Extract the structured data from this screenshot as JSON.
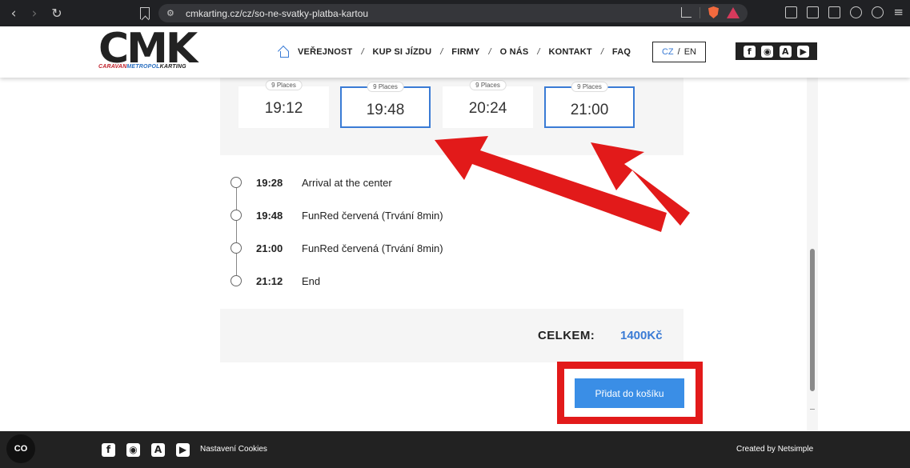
{
  "browser": {
    "url": "cmkarting.cz/cz/so-ne-svatky-platba-kartou"
  },
  "header": {
    "logo_text": "CMK",
    "logo_sub": [
      "CARAVAN",
      "METROPOL",
      "KARTING"
    ],
    "nav": [
      "VEŘEJNOST",
      "KUP SI JÍZDU",
      "FIRMY",
      "O NÁS",
      "KONTAKT",
      "FAQ"
    ],
    "lang": {
      "cz": "CZ",
      "slash": "/",
      "en": "EN"
    }
  },
  "slots": [
    {
      "badge": "9 Places",
      "time": "19:12",
      "selected": false
    },
    {
      "badge": "9 Places",
      "time": "19:48",
      "selected": true
    },
    {
      "badge": "9 Places",
      "time": "20:24",
      "selected": false
    },
    {
      "badge": "9 Places",
      "time": "21:00",
      "selected": true
    }
  ],
  "timeline": [
    {
      "time": "19:28",
      "desc": "Arrival at the center"
    },
    {
      "time": "19:48",
      "desc": "FunRed červená (Trvání 8min)"
    },
    {
      "time": "21:00",
      "desc": "FunRed červená (Trvání 8min)"
    },
    {
      "time": "21:12",
      "desc": "End"
    }
  ],
  "total": {
    "label": "CELKEM:",
    "value": "1400Kč"
  },
  "add_button": "Přidat do košíku",
  "footer": {
    "cookie_btn": "CO",
    "cookies_link": "Nastavení Cookies",
    "credit": "Created by Netsimple"
  },
  "icons": {
    "social": [
      "facebook-icon",
      "instagram-icon",
      "app-store-icon",
      "google-play-icon"
    ]
  },
  "colors": {
    "accent": "#3a7bd5",
    "annotation": "#e21a1a",
    "footer_bg": "#222222"
  }
}
